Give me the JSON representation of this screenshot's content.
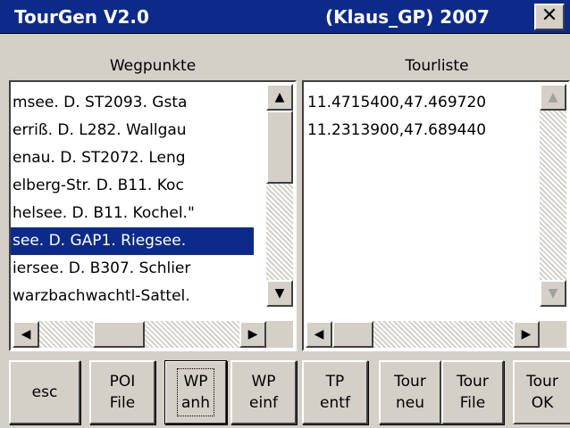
{
  "window": {
    "title_left": "TourGen V2.0",
    "title_right": "(Klaus_GP) 2007",
    "close_label": "✕"
  },
  "left_panel": {
    "heading": "Wegpunkte",
    "items": [
      "msee. D. ST2093. Gsta",
      "erriß. D. L282. Wallgau",
      "enau. D. ST2072. Leng",
      "elberg-Str. D. B11. Koc",
      "helsee. D. B11. Kochel.\"",
      "see. D. GAP1. Riegsee.",
      "iersee. D. B307. Schlier",
      "warzbachwachtl-Sattel."
    ],
    "selected_index": 5
  },
  "right_panel": {
    "heading": "Tourliste",
    "items": [
      "11.4715400,47.469720",
      "11.2313900,47.689440"
    ]
  },
  "buttons": [
    {
      "line1": "esc",
      "line2": ""
    },
    {
      "line1": "POI",
      "line2": "File"
    },
    {
      "line1": "WP",
      "line2": "anh"
    },
    {
      "line1": "WP",
      "line2": "einf"
    },
    {
      "line1": "TP",
      "line2": "entf"
    },
    {
      "line1": "Tour",
      "line2": "neu"
    },
    {
      "line1": "Tour",
      "line2": "File"
    },
    {
      "line1": "Tour",
      "line2": "OK"
    }
  ],
  "icons": {
    "up_arrow": "▲",
    "down_arrow": "▼",
    "left_arrow": "◀",
    "right_arrow": "▶"
  },
  "colors": {
    "titlebar": "#0c2a8a",
    "selection": "#0c2a8a",
    "face": "#d4d0c8"
  }
}
